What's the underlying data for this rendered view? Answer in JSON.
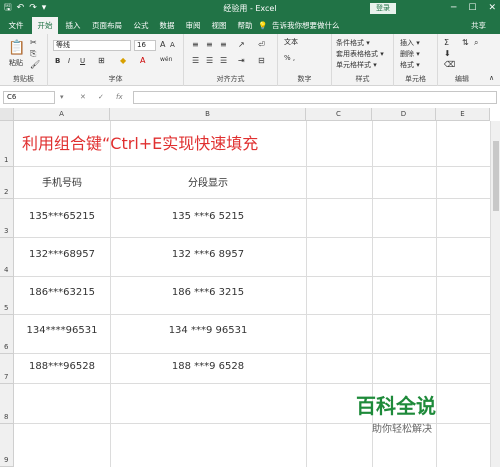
{
  "titlebar": {
    "title": "经验用 - Excel",
    "login": "登录",
    "qa_save": "🖫",
    "qa_undo": "↶",
    "qa_redo": "↷",
    "qa_more": "▾",
    "min": "─",
    "max": "☐",
    "close": "✕"
  },
  "tabs": {
    "items": [
      "文件",
      "开始",
      "插入",
      "页面布局",
      "公式",
      "数据",
      "审阅",
      "视图",
      "帮助"
    ],
    "tell_me": "告诉我你想要做什么",
    "share": "共享"
  },
  "ribbon": {
    "clipboard": {
      "paste": "粘贴",
      "label": "剪贴板"
    },
    "font": {
      "name": "等线",
      "size": "16",
      "bold": "B",
      "italic": "I",
      "underline": "U",
      "label": "字体",
      "wen": "wén"
    },
    "alignment": {
      "label": "对齐方式"
    },
    "number": {
      "format": "文本",
      "percent": "% ,",
      "label": "数字"
    },
    "styles": {
      "conditional": "条件格式 ▾",
      "table": "套用表格格式 ▾",
      "cell": "单元格样式 ▾",
      "label": "样式"
    },
    "cells": {
      "insert": "插入 ▾",
      "delete": "删除 ▾",
      "format": "格式 ▾",
      "label": "单元格"
    },
    "editing": {
      "label": "编辑"
    }
  },
  "formula_bar": {
    "name_box": "C6",
    "cancel": "✕",
    "enter": "✓",
    "fx": "fx",
    "value": ""
  },
  "sheet": {
    "columns": [
      "A",
      "B",
      "C",
      "D",
      "E"
    ],
    "rows": [
      "1",
      "2",
      "3",
      "4",
      "5",
      "6",
      "7",
      "8",
      "9"
    ],
    "title": "利用组合键“Ctrl+E实现快速填充",
    "header_a": "手机号码",
    "header_b": "分段显示",
    "data": [
      {
        "phone": "135***65215",
        "segmented": "135 ***6 5215"
      },
      {
        "phone": "132***68957",
        "segmented": "132 ***6 8957"
      },
      {
        "phone": "186***63215",
        "segmented": "186 ***6 3215"
      },
      {
        "phone": "134****96531",
        "segmented": "134 ***9 96531"
      },
      {
        "phone": "188***96528",
        "segmented": "188 ***9 6528"
      }
    ]
  },
  "watermark": {
    "brand": "百科全说",
    "slogan": "助你轻松解决"
  },
  "colors": {
    "excel_green": "#217346",
    "title_red": "#e03030",
    "watermark_green": "#1e8a3a"
  }
}
